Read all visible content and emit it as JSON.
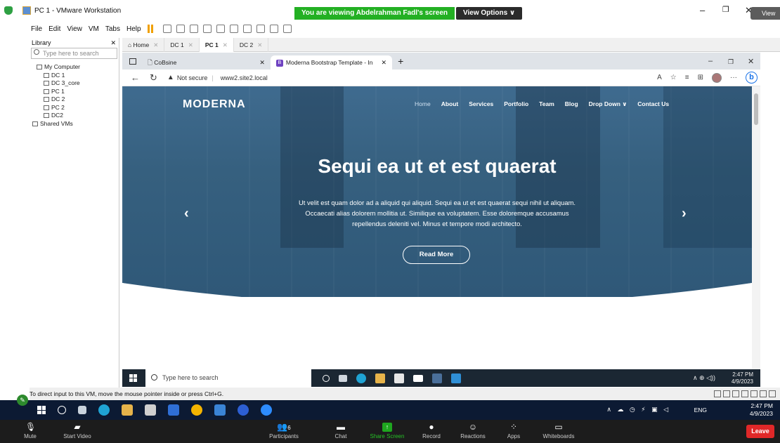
{
  "zoom": {
    "banner_text": "You are viewing Abdelrahman Fadl's screen",
    "view_options": "View Options",
    "view_btn": "View",
    "toolbar": {
      "mute": "Mute",
      "start_video": "Start Video",
      "participants": "Participants",
      "participants_count": "6",
      "chat": "Chat",
      "share_screen": "Share Screen",
      "record": "Record",
      "reactions": "Reactions",
      "apps": "Apps",
      "whiteboards": "Whiteboards",
      "leave": "Leave"
    }
  },
  "vmware": {
    "title": "PC 1 - VMware Workstation",
    "menu": [
      "File",
      "Edit",
      "View",
      "VM",
      "Tabs",
      "Help"
    ],
    "library": {
      "header": "Library",
      "search_placeholder": "Type here to search",
      "items": [
        {
          "label": "My Computer",
          "level": 1
        },
        {
          "label": "DC 1",
          "level": 2
        },
        {
          "label": "DC 3_core",
          "level": 2
        },
        {
          "label": "PC 1",
          "level": 2
        },
        {
          "label": "DC 2",
          "level": 2
        },
        {
          "label": "PC 2",
          "level": 2
        },
        {
          "label": "DC2",
          "level": 2
        },
        {
          "label": "Shared VMs",
          "level": 0
        }
      ]
    },
    "tabs": [
      "Home",
      "DC 1",
      "PC 1",
      "DC 2"
    ],
    "active_tab": "PC 1",
    "status_text": "To direct input to this VM, move the mouse pointer inside or press Ctrl+G."
  },
  "browser": {
    "tabs": [
      {
        "label": "CoBsine"
      },
      {
        "label": "Moderna Bootstrap Template - In"
      }
    ],
    "not_secure": "Not secure",
    "url": "www2.site2.local"
  },
  "website": {
    "brand": "MODERNA",
    "nav": [
      "Home",
      "About",
      "Services",
      "Portfolio",
      "Team",
      "Blog",
      "Drop Down ∨",
      "Contact Us"
    ],
    "hero_title": "Sequi ea ut et est quaerat",
    "hero_text": "Ut velit est quam dolor ad a aliquid qui aliquid. Sequi ea ut et est quaerat sequi nihil ut aliquam. Occaecati alias dolorem mollitia ut. Similique ea voluptatem. Esse doloremque accusamus repellendus deleniti vel. Minus et tempore modi architecto.",
    "read_more": "Read More"
  },
  "guest_taskbar": {
    "search_placeholder": "Type here to search",
    "time": "2:47 PM",
    "date": "4/9/2023"
  },
  "host_taskbar": {
    "lang": "ENG",
    "time": "2:47 PM",
    "date": "4/9/2023"
  },
  "colors": {
    "hero_bg": "#36607f",
    "zoom_green": "#23b023",
    "leave_red": "#e02828"
  }
}
